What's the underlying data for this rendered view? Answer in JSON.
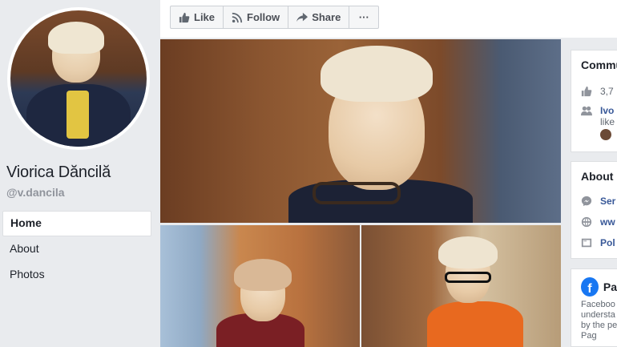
{
  "profile": {
    "name": "Viorica Dăncilă",
    "handle": "@v.dancila"
  },
  "left_nav": {
    "items": [
      {
        "label": "Home",
        "active": true
      },
      {
        "label": "About",
        "active": false
      },
      {
        "label": "Photos",
        "active": false
      }
    ]
  },
  "actions": {
    "like": "Like",
    "follow": "Follow",
    "share": "Share",
    "more": "···"
  },
  "community": {
    "title": "Commu",
    "likes_count": "3,7",
    "friend_name": "Ivo",
    "friend_text": "like"
  },
  "about": {
    "title": "About",
    "messenger_text": "Ser",
    "website_text": "ww",
    "category_text": "Pol"
  },
  "transparency": {
    "title": "Pa",
    "line1": "Faceboo",
    "line2": "understa",
    "line3": "by the pe",
    "line4": "Pag"
  },
  "colors": {
    "link": "#385898",
    "brand": "#1877f2",
    "background": "#e9ebee"
  }
}
